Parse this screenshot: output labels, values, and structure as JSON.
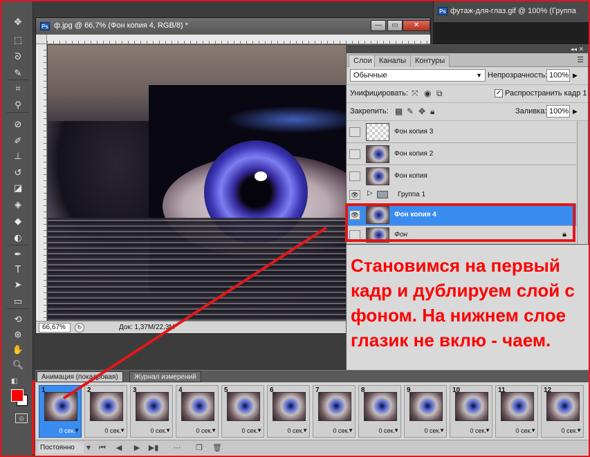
{
  "toolbox": {
    "tools": [
      "move-tool",
      "marquee-tool",
      "lasso-tool",
      "quick-select-tool",
      "crop-tool",
      "eyedropper-tool",
      "healing-brush-tool",
      "brush-tool",
      "clone-stamp-tool",
      "history-brush-tool",
      "eraser-tool",
      "paint-bucket-tool",
      "blur-tool",
      "dodge-tool",
      "pen-tool",
      "type-tool",
      "path-selection-tool",
      "shape-tool",
      "3d-rotate-tool",
      "3d-orbit-tool",
      "hand-tool",
      "zoom-tool"
    ],
    "foreground_color": "#ff0000",
    "background_color": "#ffffff"
  },
  "background_window": {
    "title": "футаж-для-глаз.gif @ 100% (Группа"
  },
  "document": {
    "title": "ф.jpg @ 66,7% (Фон копия 4, RGB/8) *",
    "zoom": "66,67%",
    "info": "Док: 1,37M/22,3M"
  },
  "layers_panel": {
    "tabs": [
      "Слои",
      "Каналы",
      "Контуры"
    ],
    "blend_mode": "Обычные",
    "opacity_label": "Непрозрачность:",
    "opacity": "100%",
    "unify_label": "Унифицировать:",
    "propagate_label": "Распространить кадр 1",
    "lock_label": "Закрепить:",
    "fill_label": "Заливка:",
    "fill": "100%",
    "layers": [
      {
        "name": "Фон копия 3",
        "visible": false,
        "thumb": "transparent"
      },
      {
        "name": "Фон копия 2",
        "visible": false,
        "thumb": "eye"
      },
      {
        "name": "Фон копия",
        "visible": false,
        "thumb": "eye"
      },
      {
        "name": "Группа 1",
        "visible": true,
        "type": "group"
      },
      {
        "name": "Фон копия 4",
        "visible": true,
        "selected": true,
        "thumb": "eye"
      },
      {
        "name": "Фон",
        "visible": false,
        "locked": true,
        "thumb": "eye"
      }
    ]
  },
  "annotation": {
    "text": "Становимся на первый кадр и дублируем слой с фоном. На нижнем слое глазик не вклю - чаем."
  },
  "animation_panel": {
    "tabs": [
      "Анимация (покадровая)",
      "Журнал измерений"
    ],
    "frames": [
      {
        "number": "1",
        "delay": "0 сек."
      },
      {
        "number": "2",
        "delay": "0 сек."
      },
      {
        "number": "3",
        "delay": "0 сек."
      },
      {
        "number": "4",
        "delay": "0 сек."
      },
      {
        "number": "5",
        "delay": "0 сек."
      },
      {
        "number": "6",
        "delay": "0 сек."
      },
      {
        "number": "7",
        "delay": "0 сек."
      },
      {
        "number": "8",
        "delay": "0 сек."
      },
      {
        "number": "9",
        "delay": "0 сек."
      },
      {
        "number": "10",
        "delay": "0 сек."
      },
      {
        "number": "11",
        "delay": "0 сек."
      },
      {
        "number": "12",
        "delay": "0 сек."
      }
    ],
    "selected_frame": "1",
    "loop": "Постоянно"
  }
}
